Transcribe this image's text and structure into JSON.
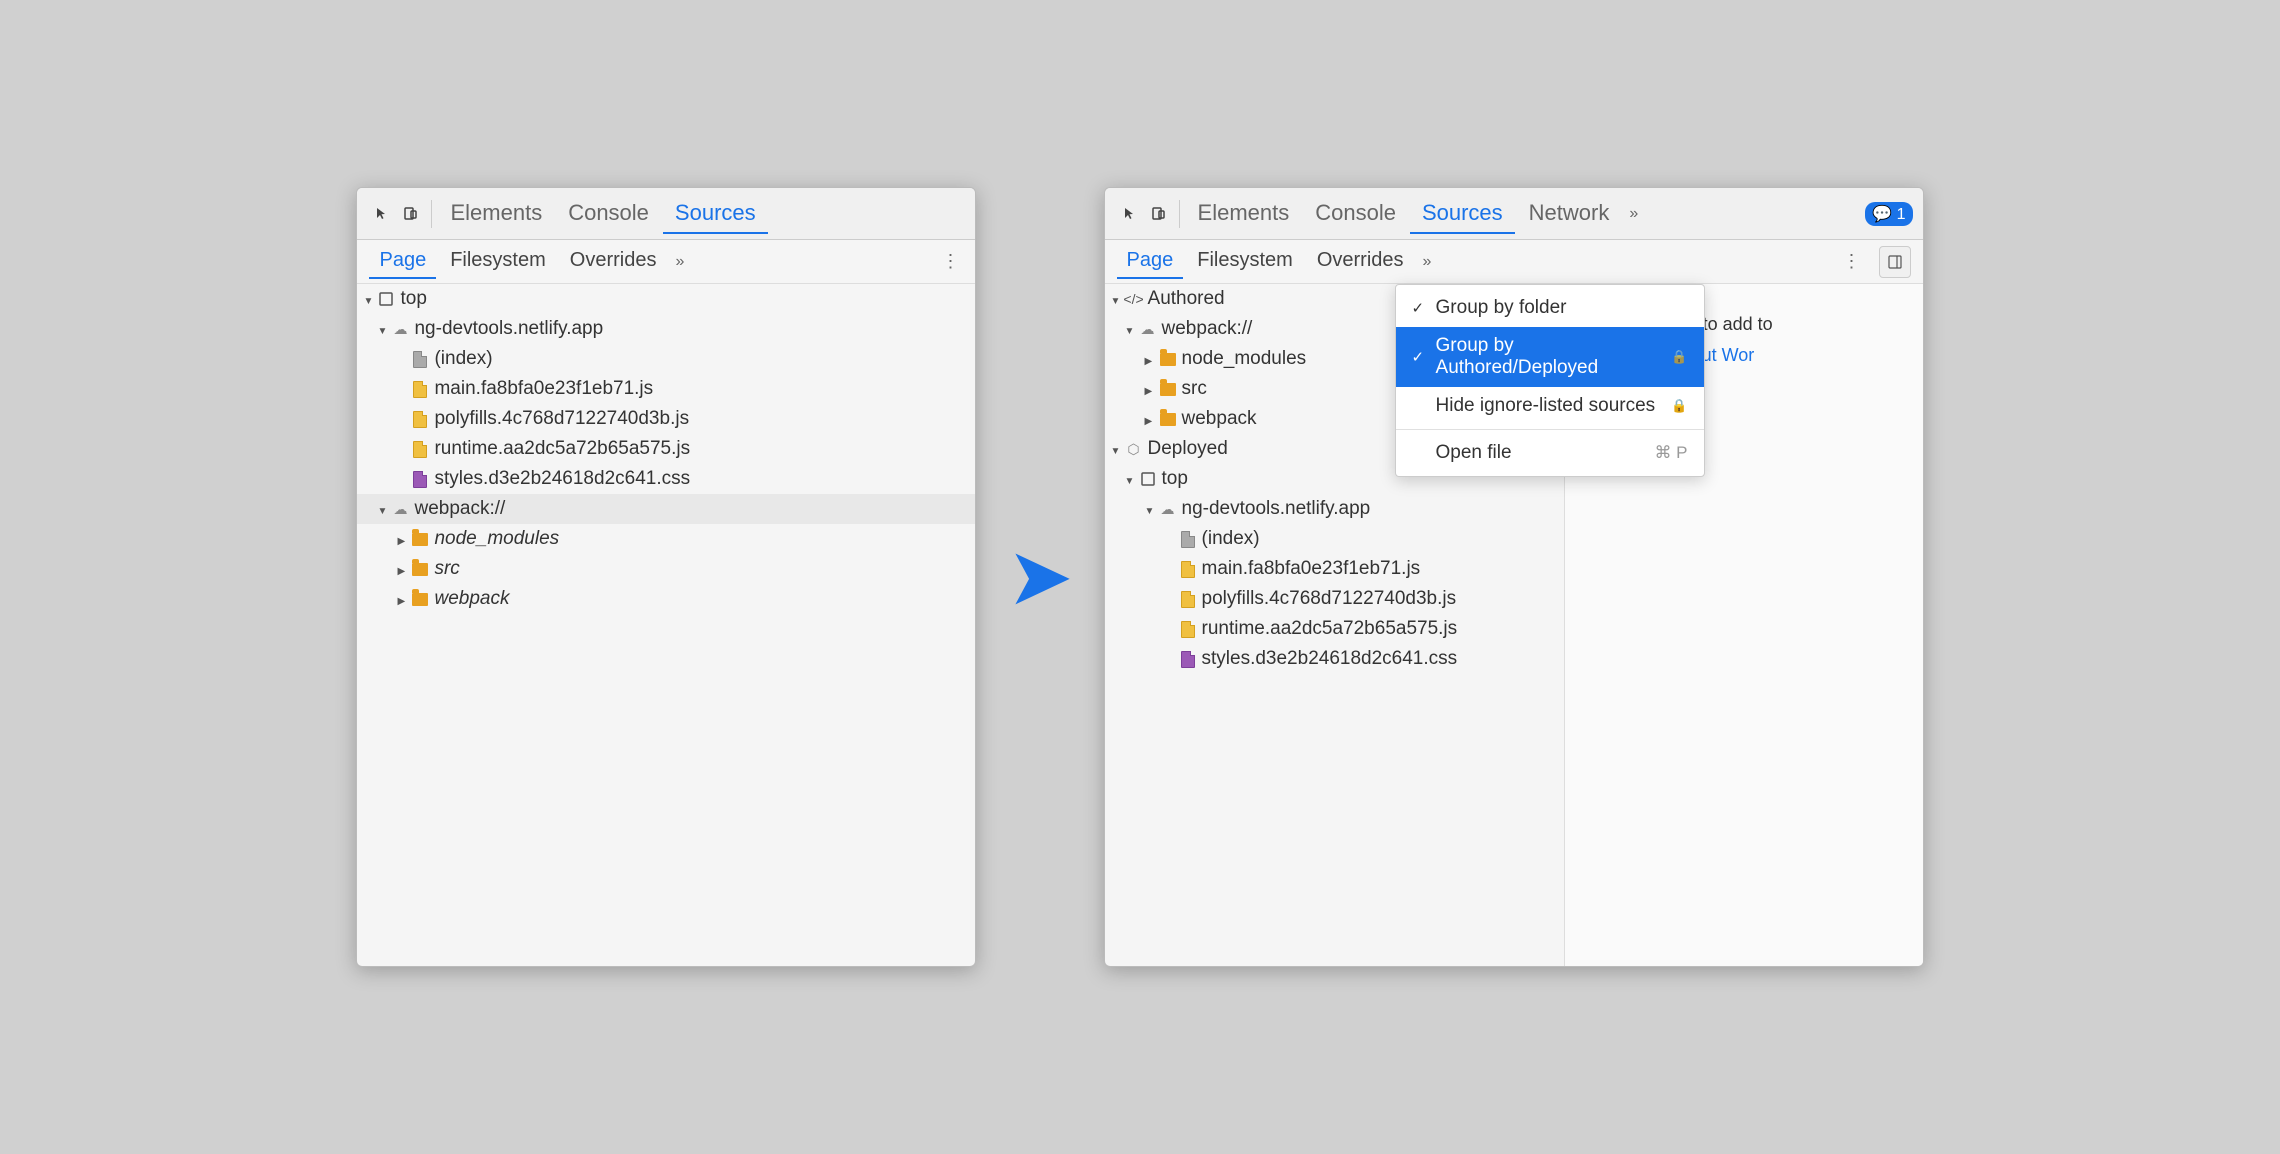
{
  "left_panel": {
    "toolbar": {
      "tabs": [
        "Elements",
        "Console",
        "Sources"
      ],
      "active_tab": "Sources"
    },
    "sub_toolbar": {
      "tabs": [
        "Page",
        "Filesystem",
        "Overrides"
      ],
      "active_tab": "Page"
    },
    "tree": [
      {
        "indent": 0,
        "arrow": "down",
        "icon": "square",
        "label": "top",
        "type": "plain"
      },
      {
        "indent": 1,
        "arrow": "down",
        "icon": "cloud",
        "label": "ng-devtools.netlify.app",
        "type": "plain"
      },
      {
        "indent": 2,
        "arrow": "none",
        "icon": "page",
        "label": "(index)",
        "type": "plain"
      },
      {
        "indent": 2,
        "arrow": "none",
        "icon": "js",
        "label": "main.fa8bfa0e23f1eb71.js",
        "type": "plain"
      },
      {
        "indent": 2,
        "arrow": "none",
        "icon": "js",
        "label": "polyfills.4c768d7122740d3b.js",
        "type": "plain"
      },
      {
        "indent": 2,
        "arrow": "none",
        "icon": "js",
        "label": "runtime.aa2dc5a72b65a575.js",
        "type": "plain"
      },
      {
        "indent": 2,
        "arrow": "none",
        "icon": "css",
        "label": "styles.d3e2b24618d2c641.css",
        "type": "plain"
      },
      {
        "indent": 1,
        "arrow": "down",
        "icon": "cloud",
        "label": "webpack://",
        "type": "highlighted"
      },
      {
        "indent": 2,
        "arrow": "right",
        "icon": "folder",
        "label": "node_modules",
        "type": "italic"
      },
      {
        "indent": 2,
        "arrow": "right",
        "icon": "folder",
        "label": "src",
        "type": "italic"
      },
      {
        "indent": 2,
        "arrow": "right",
        "icon": "folder",
        "label": "webpack",
        "type": "italic"
      }
    ]
  },
  "right_panel": {
    "toolbar": {
      "tabs": [
        "Elements",
        "Console",
        "Sources",
        "Network"
      ],
      "active_tab": "Sources",
      "badge": "1"
    },
    "sub_toolbar": {
      "tabs": [
        "Page",
        "Filesystem",
        "Overrides"
      ],
      "active_tab": "Page"
    },
    "tree": [
      {
        "indent": 0,
        "arrow": "down",
        "icon": "code",
        "label": "Authored",
        "type": "plain"
      },
      {
        "indent": 1,
        "arrow": "down",
        "icon": "cloud",
        "label": "webpack://",
        "type": "plain"
      },
      {
        "indent": 2,
        "arrow": "right",
        "icon": "folder",
        "label": "node_modules",
        "type": "plain"
      },
      {
        "indent": 2,
        "arrow": "right",
        "icon": "folder",
        "label": "src",
        "type": "plain"
      },
      {
        "indent": 2,
        "arrow": "right",
        "icon": "folder",
        "label": "webpack",
        "type": "plain"
      },
      {
        "indent": 0,
        "arrow": "down",
        "icon": "cube",
        "label": "Deployed",
        "type": "plain"
      },
      {
        "indent": 1,
        "arrow": "down",
        "icon": "square",
        "label": "top",
        "type": "plain"
      },
      {
        "indent": 2,
        "arrow": "down",
        "icon": "cloud",
        "label": "ng-devtools.netlify.app",
        "type": "plain"
      },
      {
        "indent": 3,
        "arrow": "none",
        "icon": "page",
        "label": "(index)",
        "type": "plain"
      },
      {
        "indent": 3,
        "arrow": "none",
        "icon": "js",
        "label": "main.fa8bfa0e23f1eb71.js",
        "type": "plain"
      },
      {
        "indent": 3,
        "arrow": "none",
        "icon": "js",
        "label": "polyfills.4c768d7122740d3b.js",
        "type": "plain"
      },
      {
        "indent": 3,
        "arrow": "none",
        "icon": "js",
        "label": "runtime.aa2dc5a72b65a575.js",
        "type": "plain"
      },
      {
        "indent": 3,
        "arrow": "none",
        "icon": "css",
        "label": "styles.d3e2b24618d2c641.css",
        "type": "plain"
      }
    ],
    "context_menu": {
      "items": [
        {
          "check": true,
          "label": "Group by folder",
          "shortcut": "",
          "icon_right": "",
          "selected": false
        },
        {
          "check": true,
          "label": "Group by Authored/Deployed",
          "shortcut": "",
          "icon_right": "🔒",
          "selected": true
        },
        {
          "check": false,
          "label": "Hide ignore-listed sources",
          "shortcut": "",
          "icon_right": "🔒",
          "selected": false
        },
        {
          "sep": true
        },
        {
          "check": false,
          "label": "Open file",
          "shortcut": "⌘ P",
          "icon_right": "",
          "selected": false
        }
      ]
    },
    "right_pane": {
      "text": "Drop in a folder to add to",
      "link": "Learn more about Wor"
    }
  }
}
